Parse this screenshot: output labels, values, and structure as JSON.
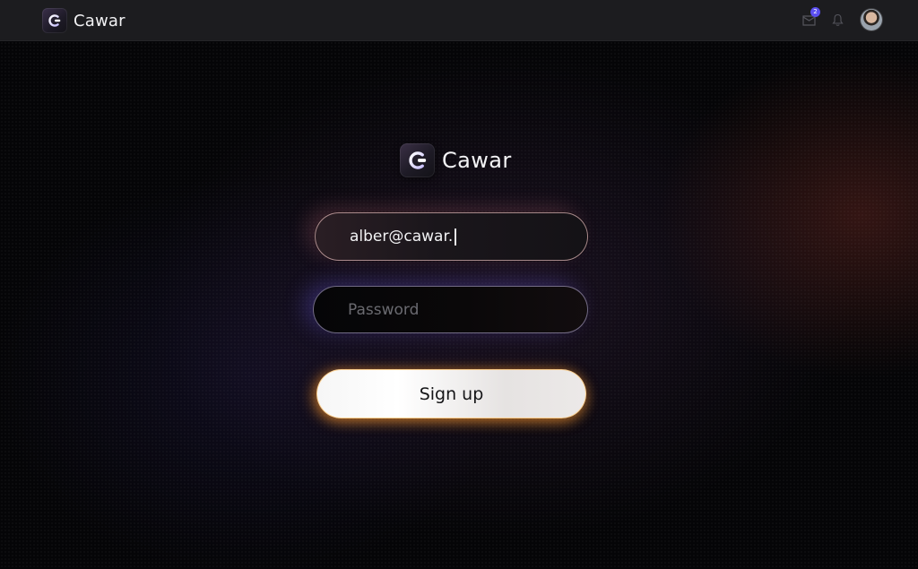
{
  "topbar": {
    "brand_name": "Cawar",
    "logo_icon": "cawar-logo-icon",
    "inbox_icon": "inbox-icon",
    "inbox_badge": "2",
    "bell_icon": "bell-icon",
    "avatar": "user-avatar"
  },
  "login": {
    "brand_name": "Cawar",
    "email_value": "alber@cawar.",
    "password_placeholder": "Password",
    "signup_label": "Sign up"
  },
  "colors": {
    "accent": "#5b4ff0",
    "button_glow": "#ff9628",
    "email_glow": "#ff8c96",
    "password_glow": "#7864ff"
  }
}
